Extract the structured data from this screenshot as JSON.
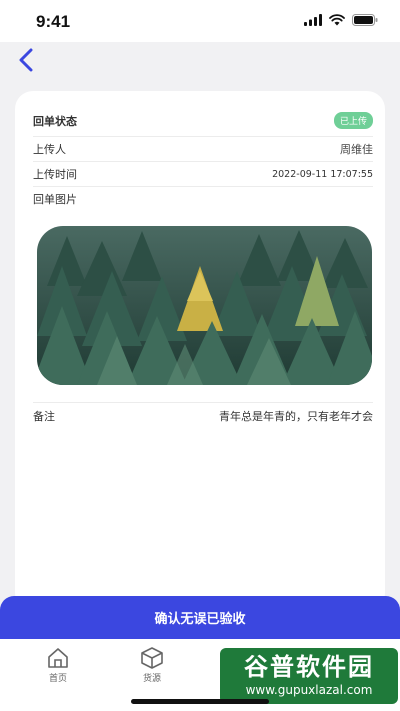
{
  "status_bar": {
    "time": "9:41"
  },
  "card": {
    "header": {
      "label": "回单状态",
      "badge": "已上传"
    },
    "uploader": {
      "label": "上传人",
      "value": "周维佳"
    },
    "upload_time": {
      "label": "上传时间",
      "value": "2022-09-11 17:07:55"
    },
    "photo": {
      "label": "回单图片"
    },
    "remark": {
      "label": "备注",
      "value": "青年总是年青的，只有老年才会"
    }
  },
  "confirm_button": {
    "label": "确认无误已验收"
  },
  "tabbar": {
    "items": [
      {
        "label": "首页",
        "icon": "home-icon"
      },
      {
        "label": "货源",
        "icon": "box-icon"
      },
      {
        "label": "",
        "icon": "edit-icon"
      },
      {
        "label": "",
        "icon": "user-icon"
      }
    ]
  },
  "watermark": {
    "title": "谷普软件园",
    "url": "www.gupuxlazal.com"
  },
  "colors": {
    "primary": "#3b47e0",
    "badge": "#6fcf97",
    "background": "#f1f1f3"
  }
}
